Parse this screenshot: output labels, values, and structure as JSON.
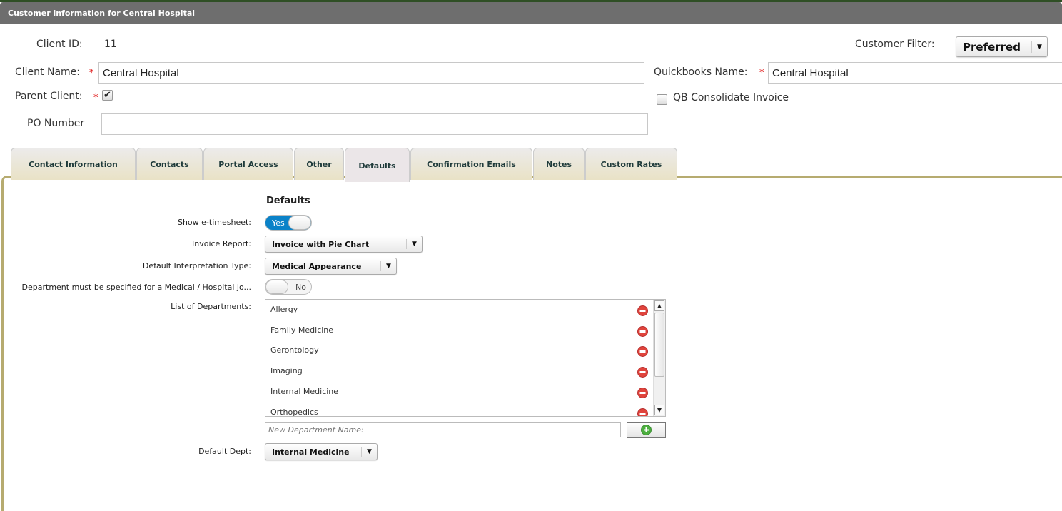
{
  "window": {
    "title": "Customer information for Central Hospital"
  },
  "form": {
    "client_id_label": "Client ID:",
    "client_id": "11",
    "client_name_label": "Client Name:",
    "client_name": "Central Hospital",
    "parent_client_label": "Parent Client:",
    "parent_client_checked": true,
    "check_glyph": "✔",
    "po_number_label": "PO Number",
    "po_number": "",
    "customer_filter_label": "Customer Filter:",
    "customer_filter": "Preferred",
    "quickbooks_name_label": "Quickbooks Name:",
    "quickbooks_name": "Central Hospital",
    "qb_consolidate_label": "QB Consolidate Invoice",
    "qb_consolidate_checked": false,
    "required_mark": "*"
  },
  "tabs": [
    {
      "label": "Contact Information"
    },
    {
      "label": "Contacts"
    },
    {
      "label": "Portal Access"
    },
    {
      "label": "Other"
    },
    {
      "label": "Defaults",
      "active": true
    },
    {
      "label": "Confirmation Emails"
    },
    {
      "label": "Notes"
    },
    {
      "label": "Custom Rates"
    }
  ],
  "defaults": {
    "heading": "Defaults",
    "show_etimesheet_label": "Show e-timesheet:",
    "show_etimesheet": "Yes",
    "invoice_report_label": "Invoice Report:",
    "invoice_report": "Invoice with Pie Chart",
    "interp_type_label": "Default Interpretation Type:",
    "interp_type": "Medical Appearance",
    "dept_required_label": "Department must be specified for a Medical / Hospital jo...",
    "dept_required": "No",
    "departments_label": "List of Departments:",
    "departments": [
      "Allergy",
      "Family Medicine",
      "Gerontology",
      "Imaging",
      "Internal Medicine",
      "Orthopedics"
    ],
    "new_dept_placeholder": "New Department Name:",
    "default_dept_label": "Default Dept:",
    "default_dept": "Internal Medicine"
  },
  "colors": {
    "accent": "#0a82c8",
    "tab_border": "#b6ab70",
    "title_bar": "#6e6e6e",
    "remove": "#e0443c",
    "add": "#4caf3f"
  }
}
